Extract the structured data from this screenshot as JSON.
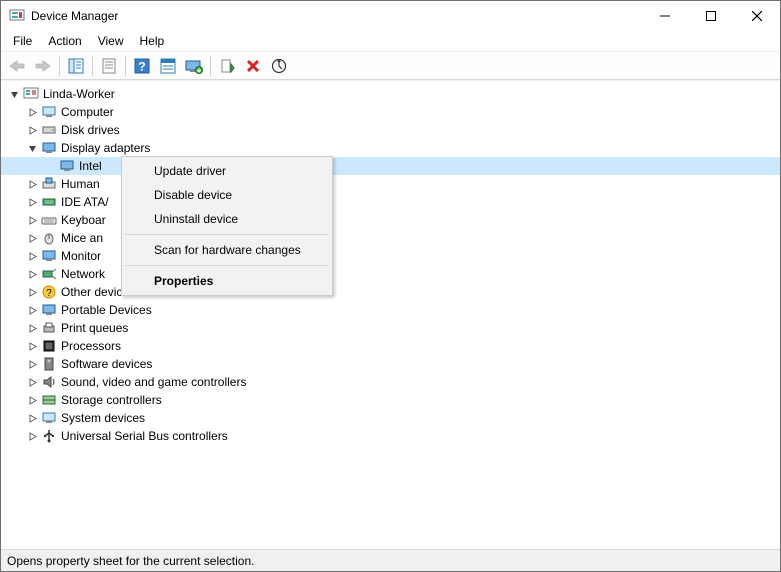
{
  "window": {
    "title": "Device Manager"
  },
  "menubar": {
    "file": "File",
    "action": "Action",
    "view": "View",
    "help": "Help"
  },
  "toolbar": {
    "back": "back-icon",
    "forward": "forward-icon",
    "show_hide": "show-hide-console-tree-icon",
    "help": "help-icon",
    "properties": "properties-icon",
    "update_driver": "update-driver-icon",
    "scan_hardware": "scan-hardware-icon",
    "uninstall": "uninstall-icon",
    "view_events": "view-events-icon",
    "disable_device": "disable-device-icon"
  },
  "tree": {
    "root": {
      "label": "Linda-Worker"
    },
    "categories": [
      {
        "label": "Computer",
        "expanded": false
      },
      {
        "label": "Disk drives",
        "expanded": false
      },
      {
        "label": "Display adapters",
        "expanded": true,
        "children": [
          {
            "label": "Intel",
            "selected": true
          }
        ]
      },
      {
        "label": "Human",
        "truncated": true
      },
      {
        "label": "IDE ATA/",
        "truncated": true
      },
      {
        "label": "Keyboar",
        "truncated": true
      },
      {
        "label": "Mice an",
        "truncated": true
      },
      {
        "label": "Monitor",
        "truncated": true
      },
      {
        "label": "Network",
        "truncated": true
      },
      {
        "label": "Other devices"
      },
      {
        "label": "Portable Devices"
      },
      {
        "label": "Print queues"
      },
      {
        "label": "Processors"
      },
      {
        "label": "Software devices"
      },
      {
        "label": "Sound, video and game controllers"
      },
      {
        "label": "Storage controllers"
      },
      {
        "label": "System devices"
      },
      {
        "label": "Universal Serial Bus controllers"
      }
    ]
  },
  "context_menu": {
    "items": [
      {
        "label": "Update driver"
      },
      {
        "label": "Disable device"
      },
      {
        "label": "Uninstall device"
      },
      {
        "sep": true
      },
      {
        "label": "Scan for hardware changes"
      },
      {
        "sep": true
      },
      {
        "label": "Properties",
        "bold": true
      }
    ]
  },
  "statusbar": {
    "text": "Opens property sheet for the current selection."
  },
  "icons": {
    "root_computer": "📇",
    "monitor": "🖥",
    "disk": "💽",
    "nic": "🔌"
  }
}
